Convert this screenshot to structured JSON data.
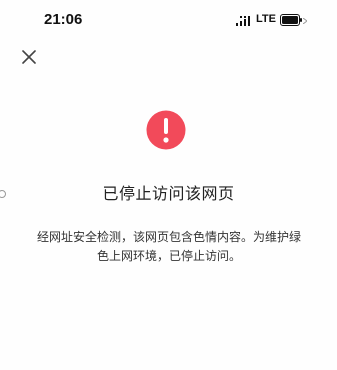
{
  "status_bar": {
    "time": "21:06",
    "network": "LTE",
    "icons": [
      "signal-icon",
      "battery-icon"
    ]
  },
  "header": {
    "close_icon": "close-icon"
  },
  "warning": {
    "icon": "exclamation-icon",
    "accent_color": "#f24a5a"
  },
  "content": {
    "title": "已停止访问该网页",
    "message_line1": "经网址安全检测，该网页包含色情内容。为维护绿",
    "message_line2": "色上网环境，已停止访问。"
  }
}
